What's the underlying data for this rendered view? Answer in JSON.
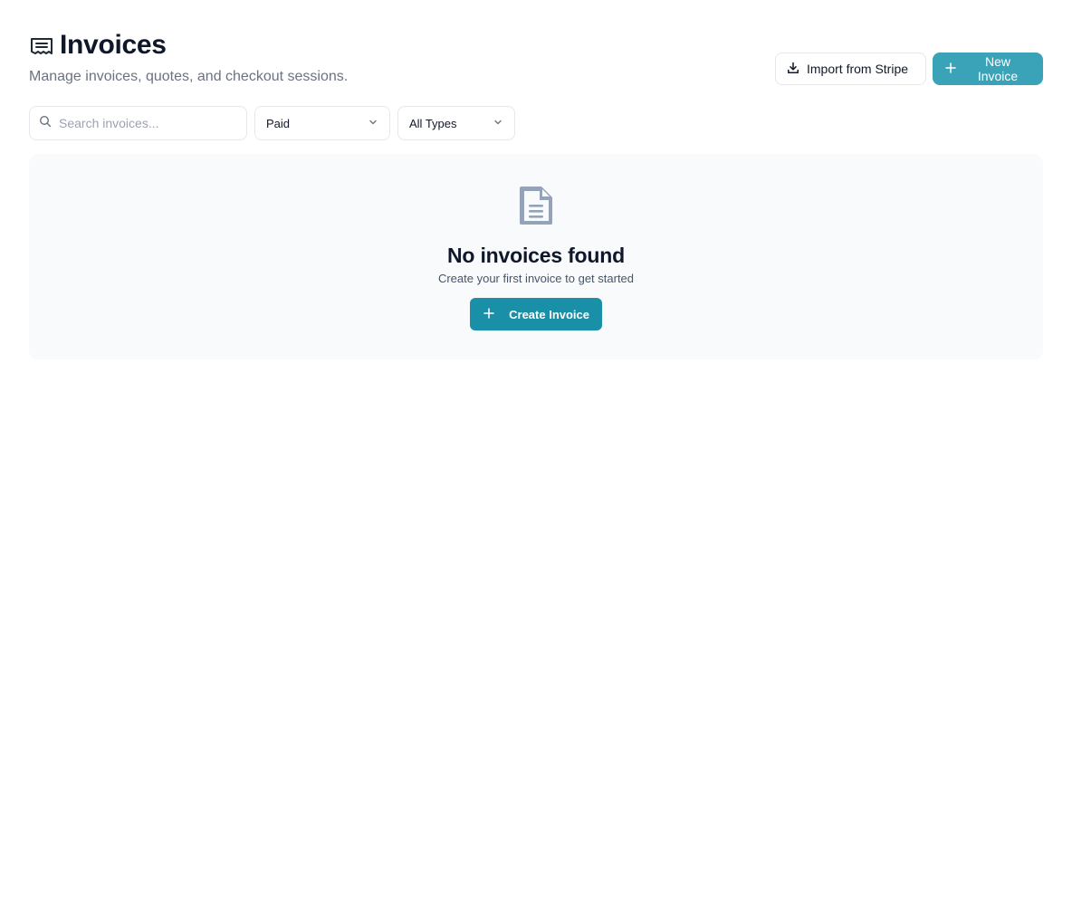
{
  "header": {
    "title": "Invoices",
    "subtitle": "Manage invoices, quotes, and checkout sessions.",
    "title_icon": "receipt-icon",
    "import_label": "Import from Stripe",
    "import_icon": "download-icon",
    "new_label": "New Invoice",
    "new_icon": "plus-icon"
  },
  "filters": {
    "search_placeholder": "Search invoices...",
    "search_value": "",
    "status_selected": "Paid",
    "type_selected": "All Types"
  },
  "empty_state": {
    "icon": "file-text-icon",
    "title": "No invoices found",
    "text": "Create your first invoice to get started",
    "button_label": "Create Invoice",
    "button_icon": "plus-icon"
  },
  "colors": {
    "primary": "#3aa3b8",
    "primary_dark": "#1a8fa8",
    "border": "#e5e7eb",
    "panel_bg": "#f8fafc",
    "muted_text": "#6b7280"
  }
}
